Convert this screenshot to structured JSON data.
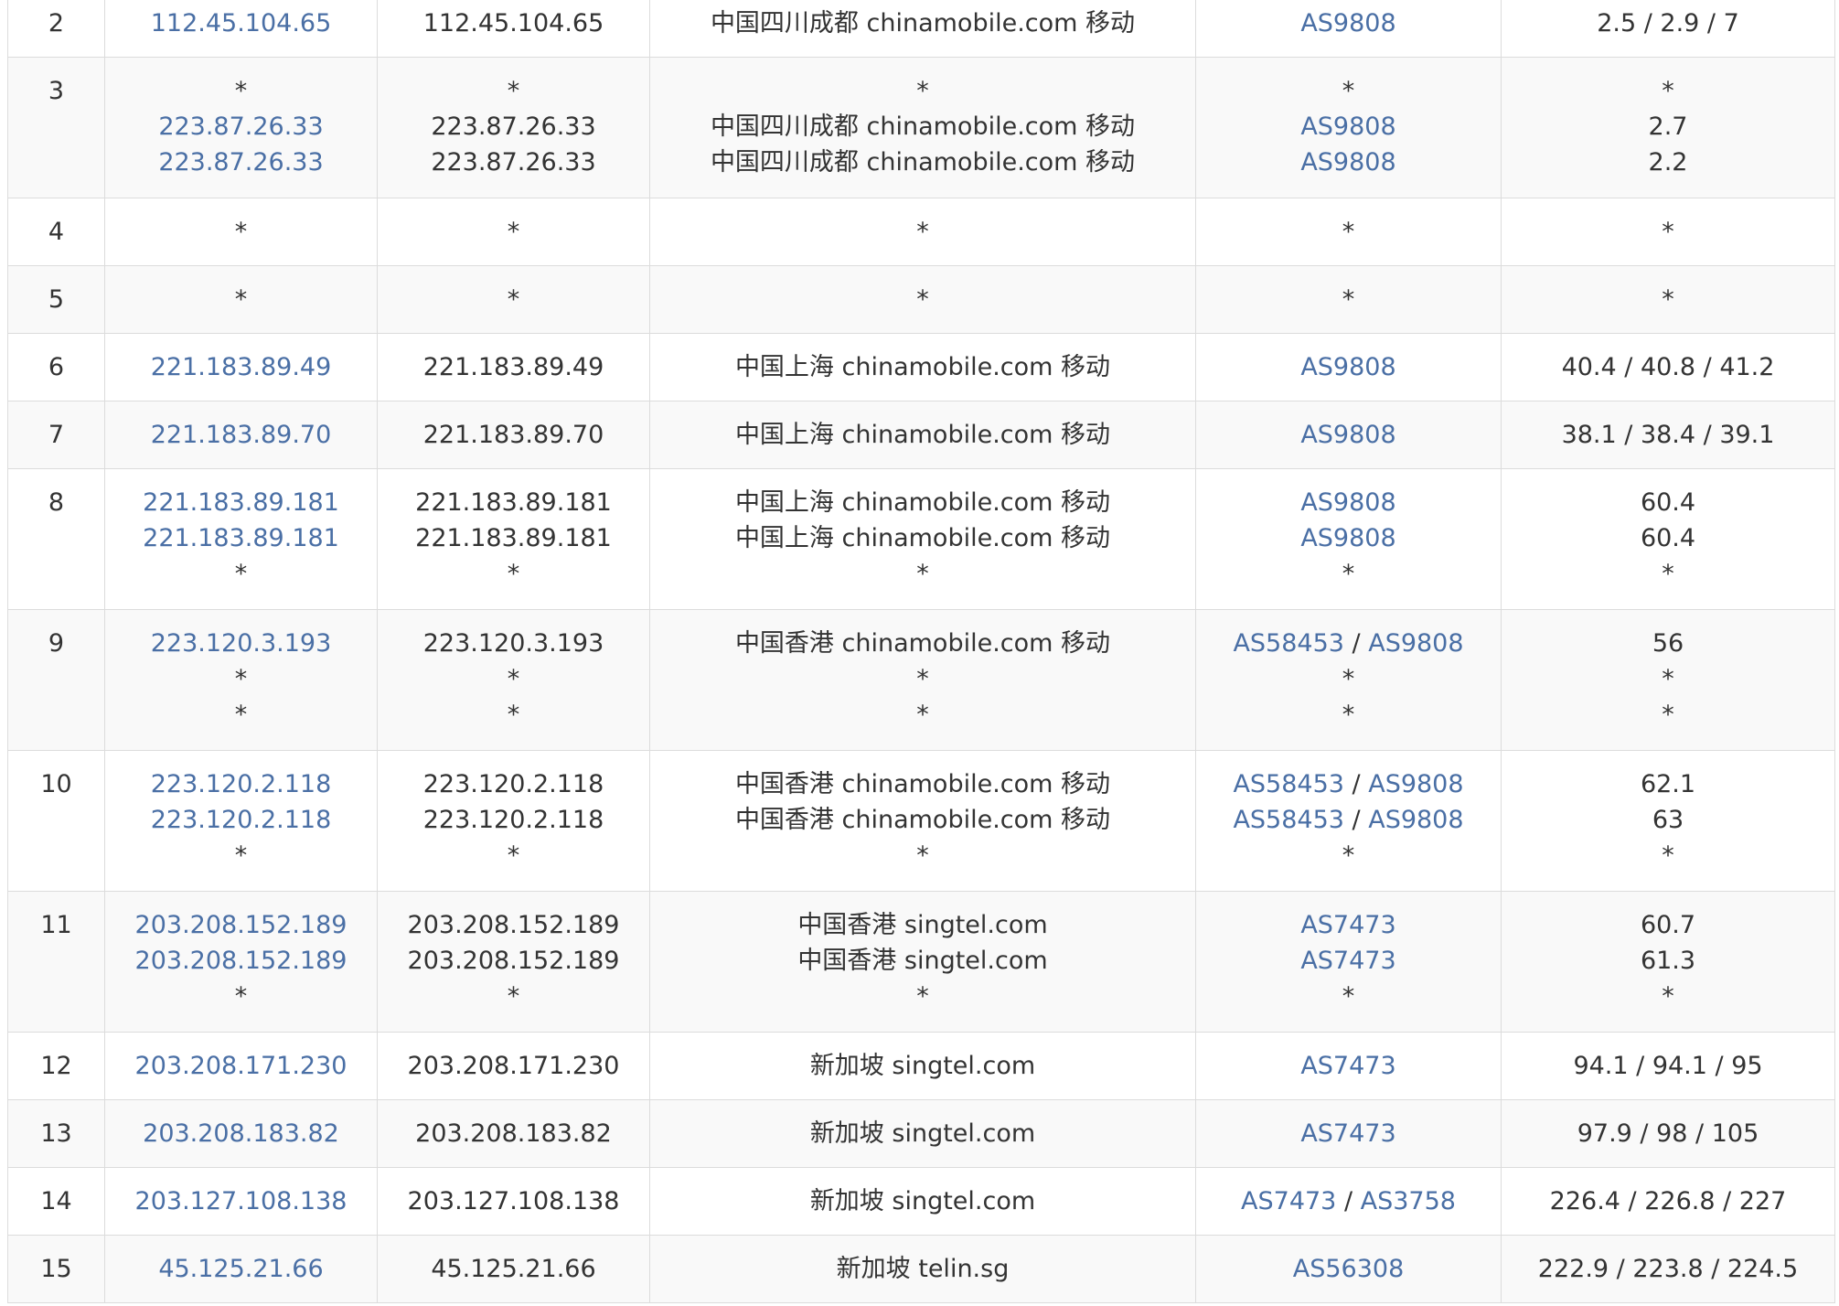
{
  "rows": [
    {
      "hop": "2",
      "lines": [
        {
          "ip": "112.45.104.65",
          "host": "112.45.104.65",
          "loc": "中国四川成都 chinamobile.com 移动",
          "asn": [
            "AS9808"
          ],
          "time": "2.5 / 2.9 / 7"
        }
      ]
    },
    {
      "hop": "3",
      "lines": [
        {
          "ip": "*",
          "host": "*",
          "loc": "*",
          "asn": [],
          "time": "*"
        },
        {
          "ip": "223.87.26.33",
          "host": "223.87.26.33",
          "loc": "中国四川成都 chinamobile.com 移动",
          "asn": [
            "AS9808"
          ],
          "time": "2.7"
        },
        {
          "ip": "223.87.26.33",
          "host": "223.87.26.33",
          "loc": "中国四川成都 chinamobile.com 移动",
          "asn": [
            "AS9808"
          ],
          "time": "2.2"
        }
      ]
    },
    {
      "hop": "4",
      "lines": [
        {
          "ip": "*",
          "host": "*",
          "loc": "*",
          "asn": [],
          "time": "*"
        }
      ]
    },
    {
      "hop": "5",
      "lines": [
        {
          "ip": "*",
          "host": "*",
          "loc": "*",
          "asn": [],
          "time": "*"
        }
      ]
    },
    {
      "hop": "6",
      "lines": [
        {
          "ip": "221.183.89.49",
          "host": "221.183.89.49",
          "loc": "中国上海 chinamobile.com 移动",
          "asn": [
            "AS9808"
          ],
          "time": "40.4 / 40.8 / 41.2"
        }
      ]
    },
    {
      "hop": "7",
      "lines": [
        {
          "ip": "221.183.89.70",
          "host": "221.183.89.70",
          "loc": "中国上海 chinamobile.com 移动",
          "asn": [
            "AS9808"
          ],
          "time": "38.1 / 38.4 / 39.1"
        }
      ]
    },
    {
      "hop": "8",
      "lines": [
        {
          "ip": "221.183.89.181",
          "host": "221.183.89.181",
          "loc": "中国上海 chinamobile.com 移动",
          "asn": [
            "AS9808"
          ],
          "time": "60.4"
        },
        {
          "ip": "221.183.89.181",
          "host": "221.183.89.181",
          "loc": "中国上海 chinamobile.com 移动",
          "asn": [
            "AS9808"
          ],
          "time": "60.4"
        },
        {
          "ip": "*",
          "host": "*",
          "loc": "*",
          "asn": [],
          "time": "*"
        }
      ]
    },
    {
      "hop": "9",
      "lines": [
        {
          "ip": "223.120.3.193",
          "host": "223.120.3.193",
          "loc": "中国香港 chinamobile.com 移动",
          "asn": [
            "AS58453",
            "AS9808"
          ],
          "time": "56"
        },
        {
          "ip": "*",
          "host": "*",
          "loc": "*",
          "asn": [],
          "time": "*"
        },
        {
          "ip": "*",
          "host": "*",
          "loc": "*",
          "asn": [],
          "time": "*"
        }
      ]
    },
    {
      "hop": "10",
      "lines": [
        {
          "ip": "223.120.2.118",
          "host": "223.120.2.118",
          "loc": "中国香港 chinamobile.com 移动",
          "asn": [
            "AS58453",
            "AS9808"
          ],
          "time": "62.1"
        },
        {
          "ip": "223.120.2.118",
          "host": "223.120.2.118",
          "loc": "中国香港 chinamobile.com 移动",
          "asn": [
            "AS58453",
            "AS9808"
          ],
          "time": "63"
        },
        {
          "ip": "*",
          "host": "*",
          "loc": "*",
          "asn": [],
          "time": "*"
        }
      ]
    },
    {
      "hop": "11",
      "lines": [
        {
          "ip": "203.208.152.189",
          "host": "203.208.152.189",
          "loc": "中国香港 singtel.com",
          "asn": [
            "AS7473"
          ],
          "time": "60.7"
        },
        {
          "ip": "203.208.152.189",
          "host": "203.208.152.189",
          "loc": "中国香港 singtel.com",
          "asn": [
            "AS7473"
          ],
          "time": "61.3"
        },
        {
          "ip": "*",
          "host": "*",
          "loc": "*",
          "asn": [],
          "time": "*"
        }
      ]
    },
    {
      "hop": "12",
      "lines": [
        {
          "ip": "203.208.171.230",
          "host": "203.208.171.230",
          "loc": "新加坡 singtel.com",
          "asn": [
            "AS7473"
          ],
          "time": "94.1 / 94.1 / 95"
        }
      ]
    },
    {
      "hop": "13",
      "lines": [
        {
          "ip": "203.208.183.82",
          "host": "203.208.183.82",
          "loc": "新加坡 singtel.com",
          "asn": [
            "AS7473"
          ],
          "time": "97.9 / 98 / 105"
        }
      ]
    },
    {
      "hop": "14",
      "lines": [
        {
          "ip": "203.127.108.138",
          "host": "203.127.108.138",
          "loc": "新加坡 singtel.com",
          "asn": [
            "AS7473",
            "AS3758"
          ],
          "time": "226.4 / 226.8 / 227"
        }
      ]
    },
    {
      "hop": "15",
      "lines": [
        {
          "ip": "45.125.21.66",
          "host": "45.125.21.66",
          "loc": "新加坡 telin.sg",
          "asn": [
            "AS56308"
          ],
          "time": "222.9 / 223.8 / 224.5"
        }
      ]
    }
  ],
  "colors": {
    "link": "#4a6fa5",
    "text": "#333333",
    "border": "#dcdcdc",
    "stripe": "#f9f9f9"
  }
}
